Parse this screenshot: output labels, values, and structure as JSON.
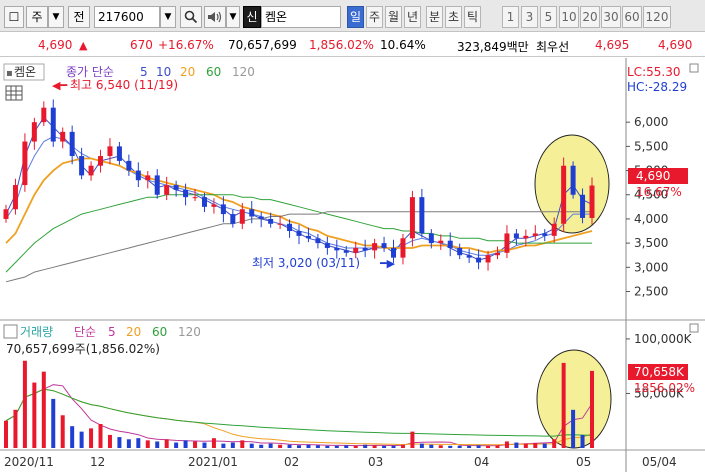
{
  "toolbar": {
    "window_btn": "☐",
    "market_label": "주",
    "jeon_label": "전",
    "code_value": "217600",
    "credit_tag": "신",
    "name_value": "켐온",
    "periods": [
      "일",
      "주",
      "월",
      "년",
      "분",
      "초",
      "틱"
    ],
    "numbers": [
      "1",
      "3",
      "5",
      "10",
      "20",
      "30",
      "60",
      "120"
    ]
  },
  "quote": {
    "price": "4,690",
    "change_mark": "▲",
    "change": "670",
    "change_pct": "+16.67%",
    "volume": "70,657,699",
    "volume_ratio": "1,856.02%",
    "turnover": "10.64%",
    "amount": "323,849백만",
    "label_best": "최우선",
    "ask": "4,695",
    "bid": "4,690"
  },
  "colors": {
    "up": "#e8192c",
    "down": "#1f3fd2",
    "ma5": "#3b4fc7",
    "ma20": "#f0a020",
    "ma60": "#2fa23a",
    "ma120": "#7a7a7a",
    "highlight": "#f5f098"
  },
  "chart": {
    "price_panel": {
      "name_tag": "켐온",
      "legend_prefix": "종가 단순",
      "legend_periods": [
        "5",
        "10",
        "20",
        "60",
        "120"
      ],
      "hi_text": "최고 6,540 (11/19)",
      "lo_text": "최저 3,020 (03/11)",
      "lc_text": "LC:55.30",
      "hc_text": "HC:-28.29",
      "price_tag": "4,690",
      "pct_tag": "16.67%"
    },
    "volume_panel": {
      "legend_name": "거래량",
      "legend_prefix": "단순",
      "legend_periods": [
        "5",
        "20",
        "60",
        "120"
      ],
      "vol_text": "70,657,699주(1,856.02%)",
      "vol_tag": "70,658K",
      "pct_tag": "1856.02%"
    },
    "date_labels": [
      "2020/11",
      "12",
      "2021/01",
      "02",
      "03",
      "04",
      "05",
      "05/04"
    ]
  },
  "chart_data": [
    {
      "type": "candlestick",
      "y_ticks": [
        "6,000",
        "5,500",
        "5,000",
        "4,500",
        "4,000",
        "3,500",
        "3,000",
        "2,500"
      ],
      "ylim": [
        2000,
        6700
      ],
      "highest": {
        "value": 6540,
        "date": "11/19"
      },
      "lowest": {
        "value": 3020,
        "date": "03/11"
      },
      "last_close": 4690,
      "series": [
        {
          "name": "5",
          "values": [
            4100,
            4500,
            5300,
            5800,
            6100,
            5900,
            5700,
            5500,
            5100,
            4900,
            5200,
            5250,
            5300,
            5100,
            4900,
            4800,
            4650,
            4700,
            4600,
            4550,
            4500,
            4400,
            4300,
            4200,
            4050,
            4150,
            4100,
            4000,
            3950,
            3900,
            3800,
            3700,
            3600,
            3550,
            3450,
            3400,
            3350,
            3300,
            3350,
            3400,
            3450,
            3300,
            3550,
            3750,
            3650,
            3550,
            3500,
            3400,
            3300,
            3250,
            3150,
            3200,
            3300,
            3450,
            3600,
            3600,
            3650,
            3700,
            3800,
            4500,
            4700,
            4400,
            4300
          ]
        },
        {
          "name": "10",
          "values": [
            4000,
            4300,
            4900,
            5300,
            5600,
            5700,
            5650,
            5500,
            5350,
            5250,
            5200,
            5150,
            5100,
            5000,
            4900,
            4800,
            4750,
            4700,
            4650,
            4600,
            4550,
            4450,
            4350,
            4250,
            4200,
            4150,
            4100,
            4050,
            3950,
            3900,
            3850,
            3750,
            3700,
            3600,
            3500,
            3450,
            3400,
            3400,
            3400,
            3400,
            3400,
            3400,
            3450,
            3550,
            3600,
            3550,
            3500,
            3450,
            3350,
            3300,
            3250,
            3250,
            3300,
            3350,
            3450,
            3500,
            3550,
            3650,
            3700,
            3900,
            4100,
            4100,
            4100
          ]
        },
        {
          "name": "20",
          "values": [
            3500,
            3700,
            4100,
            4500,
            4800,
            5000,
            5150,
            5200,
            5250,
            5250,
            5200,
            5150,
            5100,
            5000,
            4950,
            4850,
            4800,
            4750,
            4700,
            4650,
            4600,
            4550,
            4500,
            4400,
            4350,
            4250,
            4200,
            4150,
            4100,
            4050,
            3950,
            3900,
            3800,
            3750,
            3650,
            3600,
            3550,
            3500,
            3450,
            3450,
            3400,
            3400,
            3400,
            3400,
            3450,
            3450,
            3450,
            3450,
            3400,
            3400,
            3350,
            3300,
            3350,
            3350,
            3400,
            3450,
            3450,
            3500,
            3550,
            3600,
            3650,
            3700,
            3750
          ]
        },
        {
          "name": "60",
          "values": [
            2900,
            3100,
            3300,
            3500,
            3650,
            3800,
            3900,
            4000,
            4100,
            4150,
            4200,
            4250,
            4300,
            4350,
            4400,
            4450,
            4450,
            4500,
            4500,
            4500,
            4500,
            4500,
            4500,
            4500,
            4500,
            4450,
            4450,
            4400,
            4400,
            4350,
            4300,
            4250,
            4200,
            4150,
            4100,
            4050,
            4000,
            3950,
            3900,
            3850,
            3800,
            3800,
            3750,
            3750,
            3700,
            3700,
            3650,
            3650,
            3600,
            3600,
            3600,
            3550,
            3550,
            3550,
            3500,
            3500,
            3500,
            3500,
            3500,
            3500,
            3500,
            3500,
            3500
          ]
        },
        {
          "name": "120",
          "values": [
            2700,
            2750,
            2800,
            2900,
            2950,
            3000,
            3050,
            3100,
            3150,
            3200,
            3250,
            3300,
            3350,
            3400,
            3450,
            3500,
            3550,
            3600,
            3650,
            3700,
            3750,
            3800,
            3850,
            3900,
            3900,
            3950,
            4000,
            4000,
            4050,
            4050,
            4100,
            4100,
            4100,
            4100,
            4150,
            4150,
            4150,
            4150,
            4150,
            4150,
            4150,
            4150,
            4150,
            4150,
            4150,
            4150,
            4150,
            4150,
            4150,
            4150,
            4150,
            4150,
            4150,
            4150,
            4150,
            4150,
            4150,
            4150,
            4150,
            4150,
            4150,
            4150,
            4150
          ]
        }
      ],
      "ohlc_close": [
        4200,
        4700,
        5600,
        6000,
        6300,
        5600,
        5800,
        5300,
        4900,
        5100,
        5300,
        5500,
        5200,
        5000,
        4800,
        4900,
        4500,
        4700,
        4600,
        4450,
        4450,
        4250,
        4300,
        4100,
        3900,
        4200,
        4050,
        4000,
        3900,
        3900,
        3750,
        3650,
        3600,
        3500,
        3400,
        3350,
        3300,
        3400,
        3350,
        3500,
        3400,
        3200,
        3600,
        4450,
        3700,
        3500,
        3550,
        3400,
        3250,
        3200,
        3100,
        3250,
        3300,
        3700,
        3600,
        3650,
        3700,
        3650,
        3900,
        5100,
        4500,
        4020,
        4690
      ]
    },
    {
      "type": "bar",
      "y_ticks": [
        "100,000K",
        "50,000K"
      ],
      "ylim": [
        0,
        110000
      ],
      "values": [
        25000,
        35000,
        80000,
        60000,
        70000,
        45000,
        30000,
        20000,
        15000,
        18000,
        22000,
        12000,
        10000,
        8000,
        9000,
        7000,
        6000,
        8000,
        5000,
        7000,
        6000,
        5000,
        9000,
        4000,
        5000,
        7000,
        4000,
        3000,
        4000,
        3000,
        3000,
        2500,
        3000,
        2500,
        2000,
        2000,
        2500,
        2000,
        3000,
        2500,
        2000,
        2000,
        3000,
        15000,
        4000,
        3000,
        2500,
        2000,
        2000,
        2000,
        2500,
        2000,
        2500,
        6000,
        5000,
        4000,
        4500,
        4000,
        8000,
        78000,
        35000,
        12000,
        70658
      ],
      "last_value": "70,658K"
    }
  ]
}
